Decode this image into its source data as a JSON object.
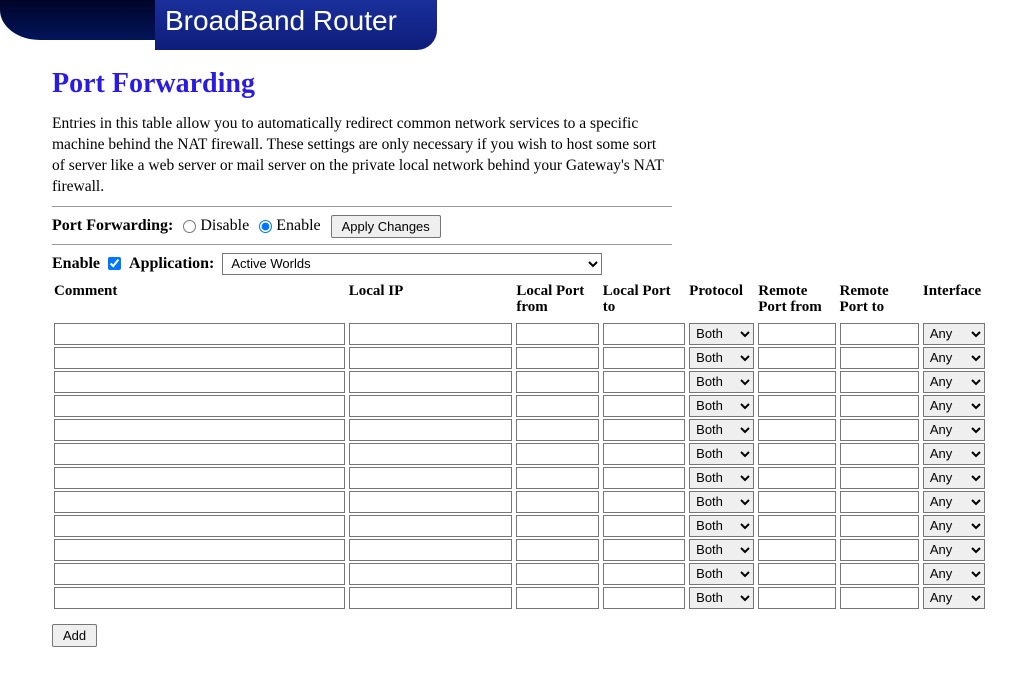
{
  "header": {
    "brand": "BroadBand Router"
  },
  "page": {
    "title": "Port Forwarding",
    "description": "Entries in this table allow you to automatically redirect common network services to a specific machine behind the NAT firewall. These settings are only necessary if you wish to host some sort of server like a web server or mail server on the private local network behind your Gateway's NAT firewall."
  },
  "controls": {
    "section_label": "Port Forwarding:",
    "disable_label": "Disable",
    "enable_label": "Enable",
    "apply_label": "Apply Changes",
    "row_enable_label": "Enable",
    "application_label": "Application:",
    "application_selected": "Active Worlds",
    "add_label": "Add"
  },
  "table": {
    "headers": {
      "comment": "Comment",
      "local_ip": "Local IP",
      "local_port_from": "Local Port from",
      "local_port_to": "Local Port to",
      "protocol": "Protocol",
      "remote_port_from": "Remote Port from",
      "remote_port_to": "Remote Port to",
      "interface": "Interface"
    },
    "row_count": 12,
    "defaults": {
      "protocol": "Both",
      "interface": "Any"
    }
  }
}
